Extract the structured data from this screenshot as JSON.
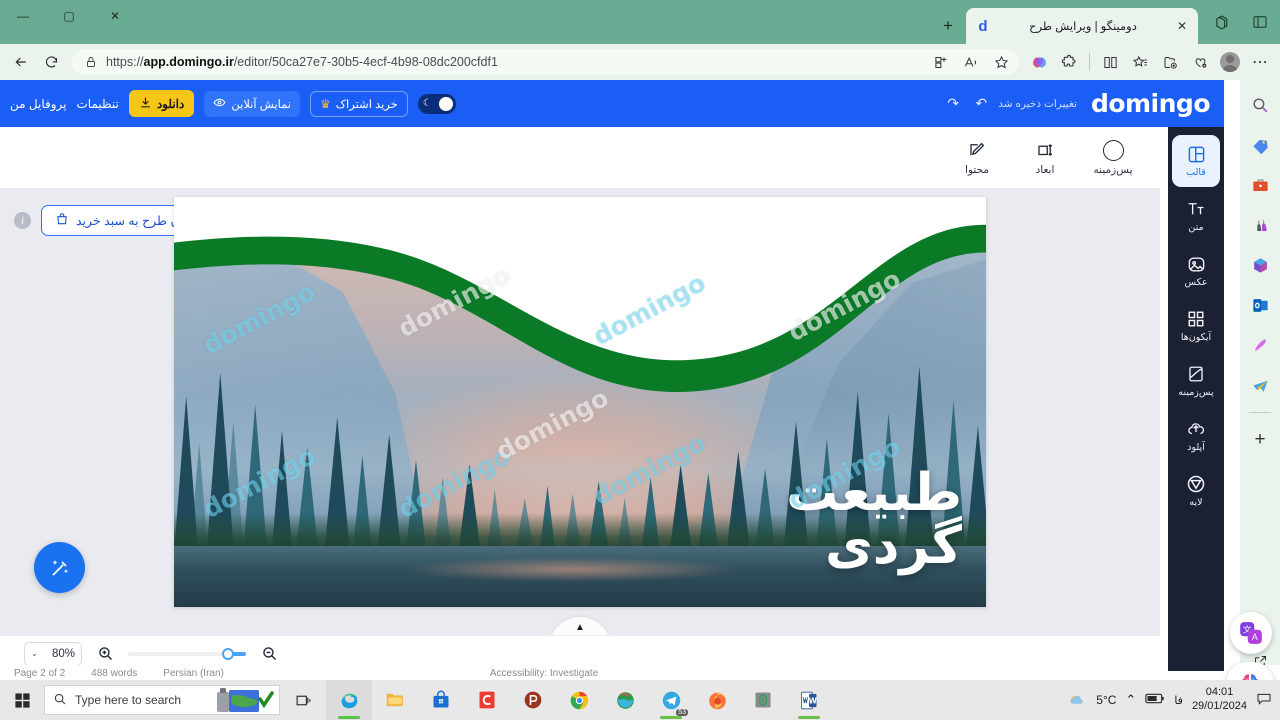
{
  "browser": {
    "tab_title": "دومینگو | ویرایش طرح",
    "tab_close_glyph": "✕",
    "new_tab_glyph": "+",
    "url_prefix": "https://",
    "url_host": "app.domingo.ir",
    "url_path": "/editor/50ca27e7-30b5-4ecf-4b98-08dc200cfdf1",
    "minimize_glyph": "—",
    "maximize_glyph": "▢",
    "close_glyph": "✕",
    "back_glyph": "←",
    "reload_glyph": "⟳",
    "lock_icon": "🔒",
    "icons": {
      "split_screen": "⊞",
      "read_aloud": "A",
      "favorite": "☆",
      "copilot": "◉",
      "extensions": "🧩",
      "split_view": "◫",
      "collections": "☆",
      "add_favorite": "⊕",
      "browser_essentials": "♡",
      "settings_more": "⋯"
    },
    "sidebar_icons": [
      "search-icon",
      "shopping-icon",
      "tools-icon",
      "games-icon",
      "office-icon",
      "outlook-icon",
      "designer-icon",
      "telegram-icon"
    ],
    "sidebar_add_glyph": "+",
    "sidebar_open_glyph": "⧉",
    "sidebar_settings_glyph": "⚙"
  },
  "app": {
    "logo_text": "domingo",
    "save_status": "تغییرات ذخیره شد",
    "undo_glyph": "↶",
    "redo_glyph": "↷",
    "dark_toggle_moon": "☾",
    "subscribe_label": "خرید اشتراک",
    "subscribe_crown": "♛",
    "preview_label": "نمایش آنلاین",
    "preview_eye": "◉",
    "download_label": "دانلود",
    "download_glyph": "⭳",
    "settings_label": "تنظیمات",
    "profile_label": "پروفایل من"
  },
  "subtoolbar": {
    "items": [
      {
        "label": "محتوا",
        "icon": "pencil-edit-icon",
        "glyph": "✎"
      },
      {
        "label": "ابعاد",
        "icon": "resize-icon",
        "glyph": "⇳"
      },
      {
        "label": "پس‌زمینه",
        "icon": "background-circle-icon",
        "glyph": ""
      }
    ]
  },
  "canvas": {
    "cart_button_label": "افزودن طرح به سبد خرید",
    "cart_icon": "🛍",
    "info_glyph": "i",
    "magic_fab_icon": "✨",
    "collapse_glyph": "▲",
    "design": {
      "headline_line1": "طبیعت",
      "headline_line2": "گردی",
      "watermark_text": "domingo"
    }
  },
  "zoombar": {
    "zoom_value": "80%",
    "chevron": "⌄",
    "zoom_in_glyph": "⊕",
    "zoom_out_glyph": "⊖",
    "slider_percent": 80
  },
  "word_status": {
    "page": "Page 2 of 2",
    "words": "488 words",
    "lang_icon": "文",
    "language": "Persian (Iran)",
    "accessibility": "Accessibility: Investigate"
  },
  "rail": {
    "items": [
      {
        "label": "قالب",
        "icon": "layout-template-icon",
        "glyph": "▣",
        "active": true
      },
      {
        "label": "متن",
        "icon": "text-icon",
        "glyph": "T",
        "active": false
      },
      {
        "label": "عکس",
        "icon": "image-icon",
        "glyph": "🖼",
        "active": false
      },
      {
        "label": "آیکون‌ها",
        "icon": "grid-icons-icon",
        "glyph": "▤",
        "active": false
      },
      {
        "label": "پس‌زمینه",
        "icon": "background-panel-icon",
        "glyph": "◫",
        "active": false
      },
      {
        "label": "آپلود",
        "icon": "upload-cloud-icon",
        "glyph": "☁",
        "active": false
      },
      {
        "label": "لایه",
        "icon": "shapes-icon",
        "glyph": "▽",
        "active": false
      }
    ],
    "float_translate_icon": "translate-icon",
    "float_ai_icon": "ai-brain-icon"
  },
  "taskbar": {
    "search_placeholder": "Type here to search",
    "search_icon": "🔍",
    "start_icon": "⊞",
    "task_view_icon": "❐",
    "apps": [
      {
        "name": "edge",
        "glyph": "e"
      },
      {
        "name": "file-explorer",
        "glyph": "📁"
      },
      {
        "name": "microsoft-store",
        "glyph": "🛍"
      },
      {
        "name": "c-app",
        "glyph": "C"
      },
      {
        "name": "p-app",
        "glyph": "P"
      },
      {
        "name": "chrome",
        "glyph": "◉"
      },
      {
        "name": "world-app",
        "glyph": "🌎"
      },
      {
        "name": "telegram",
        "glyph": "✈",
        "badge": "53"
      },
      {
        "name": "firefox",
        "glyph": "🦊"
      },
      {
        "name": "green-app",
        "glyph": "▤"
      },
      {
        "name": "word",
        "glyph": "W"
      }
    ],
    "weather_temp": "5°C",
    "weather_icon": "⛅",
    "tray_chevron": "⌃",
    "tray_battery": "🔋",
    "tray_lang": "فا",
    "clock_time": "04:01",
    "clock_date": "29/01/2024",
    "notification_glyph": "▭"
  },
  "colors": {
    "titlebar_green": "#6aab94",
    "toolbar_green": "#eaf4ec",
    "app_blue": "#1b5ef5",
    "download_yellow": "#f5c518",
    "rail_dark": "#1b2033",
    "accent_blue": "#2f74fb",
    "wave_green": "#0a7a26"
  }
}
